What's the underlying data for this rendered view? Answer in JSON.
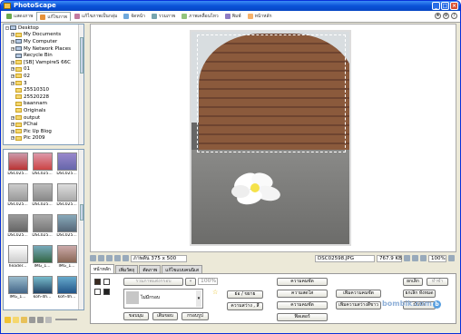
{
  "window": {
    "title": "PhotoScape"
  },
  "tabs": [
    {
      "label": "แสดงภาพ",
      "color": "#6aa84f"
    },
    {
      "label": "แก้ไขภาพ",
      "color": "#e69138"
    },
    {
      "label": "แก้ไขภาพเป็นกลุ่ม",
      "color": "#c27ba0"
    },
    {
      "label": "จัดหน้า",
      "color": "#6fa8dc"
    },
    {
      "label": "รวมภาพ",
      "color": "#76a5af"
    },
    {
      "label": "ภาพเคลื่อนไหว",
      "color": "#93c47d"
    },
    {
      "label": "พิมพ์",
      "color": "#8e7cc3"
    },
    {
      "label": "หน้าหลัก",
      "color": "#f6b26b"
    }
  ],
  "tree": {
    "items": [
      {
        "label": "Desktop",
        "type": "pc",
        "expand": "-",
        "indent": 0
      },
      {
        "label": "My Documents",
        "type": "folder",
        "expand": "+",
        "indent": 1
      },
      {
        "label": "My Computer",
        "type": "pc",
        "expand": "+",
        "indent": 1
      },
      {
        "label": "My Network Places",
        "type": "pc",
        "expand": "+",
        "indent": 1
      },
      {
        "label": "Recycle Bin",
        "type": "pc",
        "expand": "",
        "indent": 1
      },
      {
        "label": "[SB] VampireS 66C",
        "type": "folder",
        "expand": "+",
        "indent": 1
      },
      {
        "label": "01",
        "type": "folder",
        "expand": "+",
        "indent": 1
      },
      {
        "label": "02",
        "type": "folder",
        "expand": "+",
        "indent": 1
      },
      {
        "label": "3",
        "type": "folder",
        "expand": "+",
        "indent": 1
      },
      {
        "label": "25510310",
        "type": "folder",
        "expand": "",
        "indent": 1
      },
      {
        "label": "25520228",
        "type": "folder",
        "expand": "",
        "indent": 1
      },
      {
        "label": "baannam",
        "type": "folder",
        "expand": "",
        "indent": 1
      },
      {
        "label": "Originals",
        "type": "folder",
        "expand": "",
        "indent": 1
      },
      {
        "label": "output",
        "type": "folder",
        "expand": "+",
        "indent": 1
      },
      {
        "label": "PChai",
        "type": "folder",
        "expand": "+",
        "indent": 1
      },
      {
        "label": "Pic Up Blog",
        "type": "folder",
        "expand": "+",
        "indent": 1
      },
      {
        "label": "Pic 2009",
        "type": "folder",
        "expand": "+",
        "indent": 1
      }
    ]
  },
  "thumbnails": [
    {
      "label": "DSC025...",
      "c1": "#c9a",
      "c2": "#b33"
    },
    {
      "label": "DSC025...",
      "c1": "#d9a",
      "c2": "#c44"
    },
    {
      "label": "DSC025...",
      "c1": "#98c",
      "c2": "#66a"
    },
    {
      "label": "DSC025...",
      "c1": "#ccc",
      "c2": "#999"
    },
    {
      "label": "DSC025...",
      "c1": "#bbb",
      "c2": "#888"
    },
    {
      "label": "DSC025...",
      "c1": "#ddd",
      "c2": "#aaa"
    },
    {
      "label": "DSC025...",
      "c1": "#999",
      "c2": "#666"
    },
    {
      "label": "DSC025...",
      "c1": "#aaa",
      "c2": "#777"
    },
    {
      "label": "DSC025...",
      "c1": "#8ab",
      "c2": "#567"
    },
    {
      "label": "header...",
      "c1": "#fff",
      "c2": "#ccc"
    },
    {
      "label": "IMG_1...",
      "c1": "#7ab",
      "c2": "#364"
    },
    {
      "label": "IMG_1...",
      "c1": "#caa",
      "c2": "#865"
    },
    {
      "label": "IMG_1...",
      "c1": "#9bc",
      "c2": "#468"
    },
    {
      "label": "koh-4h...",
      "c1": "#7bc",
      "c2": "#246"
    },
    {
      "label": "koh-4h...",
      "c1": "#6ac",
      "c2": "#258"
    }
  ],
  "status": {
    "size_label": "ภาพต้น 375 x 500",
    "filename": "DSC02598.JPG",
    "filesize": "767.9 KB",
    "zoom": "100%"
  },
  "edit_tabs": [
    "หน้าหลัก",
    "เพิ่มวัตถุ",
    "ตัดภาพ",
    "แก้ไขแบบคนนิเส"
  ],
  "panel": {
    "frame_dropdown": "รวมภาพแต่งกรอบ",
    "frame_percent": "100%",
    "frame_name": "ไม่มีกรอบ",
    "btn_margin": "ขอบมุม",
    "btn_addframe": "เติมขอบ",
    "btn_framepic": "กรอบรูป",
    "btn_resize": "ย่อ / ขยาย",
    "btn_autolevel": "ความสว่าง , สี",
    "btn_brightness": "ความคมชัด",
    "btn_contrast": "ความสดใส",
    "btn_brightcolor": "ความคมชัด",
    "btn_filter": "ฟิลเตอร์",
    "btn_sharpen": "เพิ่มความคมชัด",
    "btn_backlight": "เพิ่มความสว่างสีขาว",
    "btn_undo": "ยกเลิก",
    "btn_redo": "ทำซ้ำ",
    "btn_undoall": "ยกเลิก ทั้งหมด",
    "btn_save": "บันทึก"
  },
  "watermark": {
    "text": "bombik.com",
    "badge": "b"
  }
}
